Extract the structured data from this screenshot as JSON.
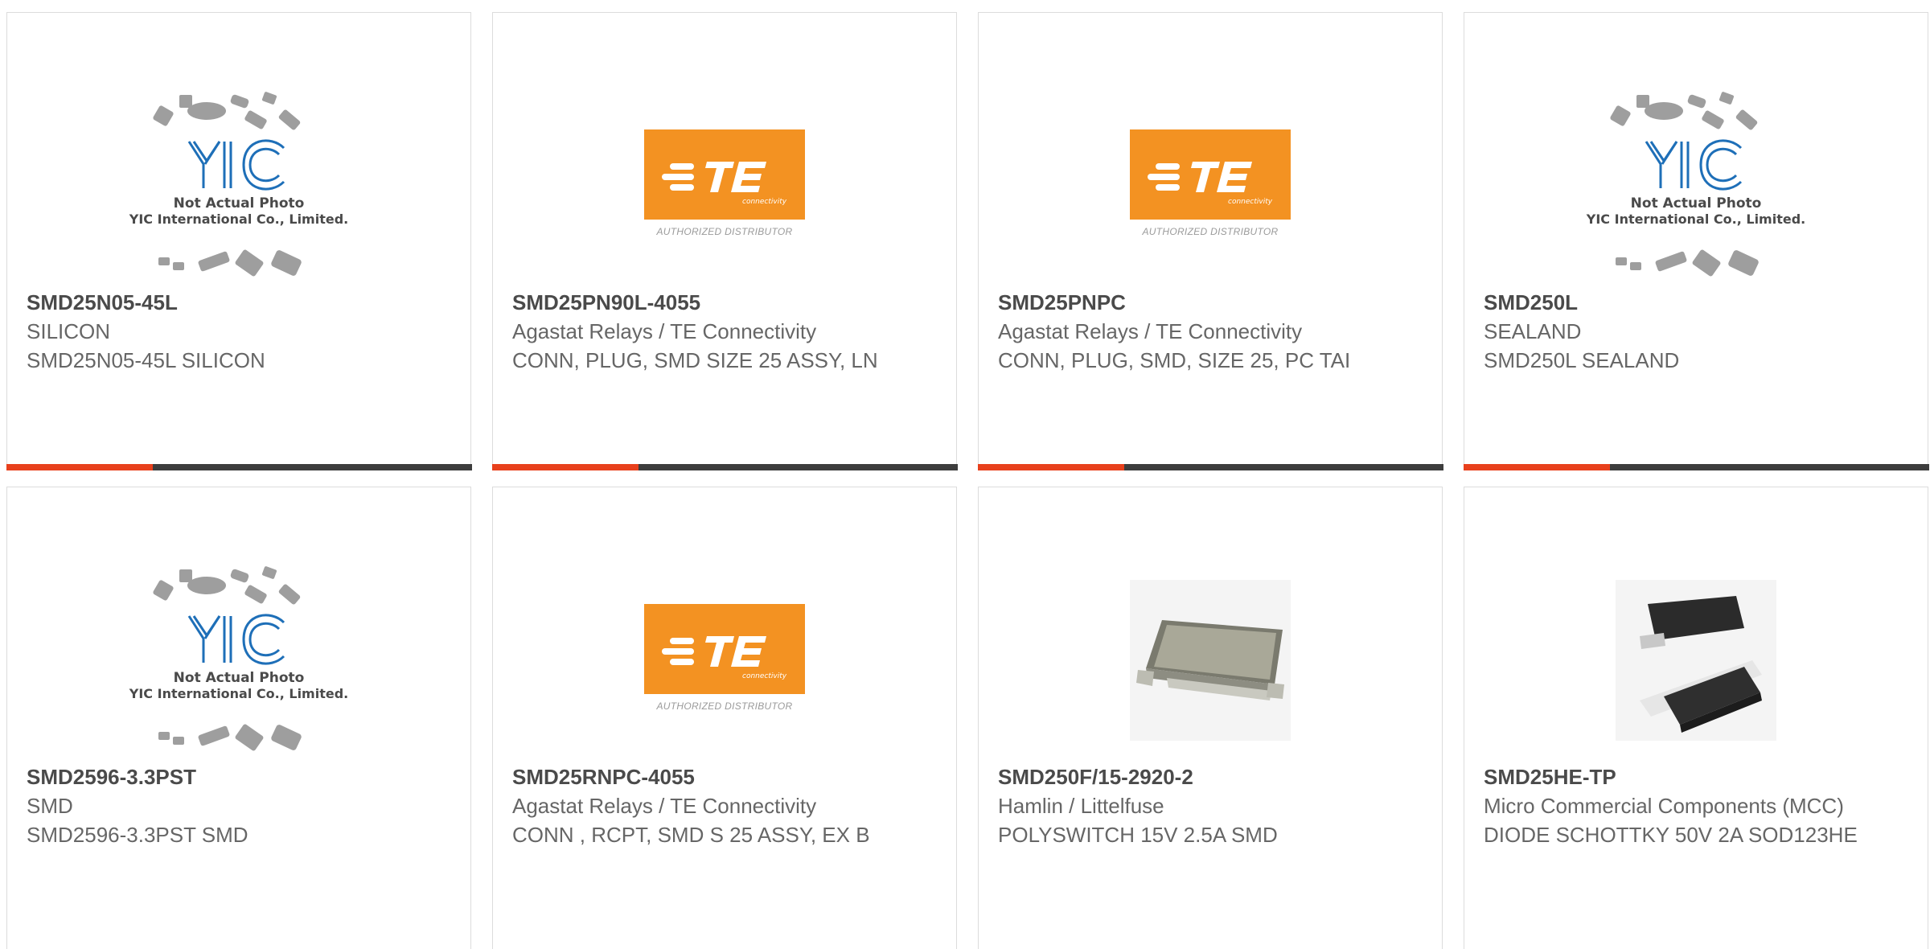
{
  "theme": {
    "accent": "#e8401c",
    "bar": "#3d3d3d",
    "border": "#dcdcdc",
    "te_orange": "#f39222",
    "yic_blue": "#1e6fb8"
  },
  "placeholder": {
    "line1": "Not Actual Photo",
    "line2": "YIC International Co., Limited.",
    "te_tag": "AUTHORIZED DISTRIBUTOR",
    "te_sub": "connectivity"
  },
  "products": [
    {
      "part": "SMD25N05-45L",
      "manufacturer": "SILICON",
      "description": "SMD25N05-45L SILICON",
      "image": "yic-placeholder"
    },
    {
      "part": "SMD25PN90L-4055",
      "manufacturer": "Agastat Relays / TE Connectivity",
      "description": "CONN, PLUG, SMD SIZE 25 ASSY, LN",
      "image": "te-logo"
    },
    {
      "part": "SMD25PNPC",
      "manufacturer": "Agastat Relays / TE Connectivity",
      "description": "CONN, PLUG, SMD, SIZE 25, PC TAI",
      "image": "te-logo"
    },
    {
      "part": "SMD250L",
      "manufacturer": "SEALAND",
      "description": "SMD250L SEALAND",
      "image": "yic-placeholder"
    },
    {
      "part": "SMD2596-3.3PST",
      "manufacturer": "SMD",
      "description": "SMD2596-3.3PST SMD",
      "image": "yic-placeholder"
    },
    {
      "part": "SMD25RNPC-4055",
      "manufacturer": "Agastat Relays / TE Connectivity",
      "description": "CONN , RCPT, SMD S 25 ASSY, EX B",
      "image": "te-logo"
    },
    {
      "part": "SMD250F/15-2920-2",
      "manufacturer": "Hamlin / Littelfuse",
      "description": "POLYSWITCH 15V 2.5A SMD",
      "image": "polyswitch-photo"
    },
    {
      "part": "SMD25HE-TP",
      "manufacturer": "Micro Commercial Components (MCC)",
      "description": "DIODE SCHOTTKY 50V 2A SOD123HE",
      "image": "diode-photo"
    }
  ]
}
